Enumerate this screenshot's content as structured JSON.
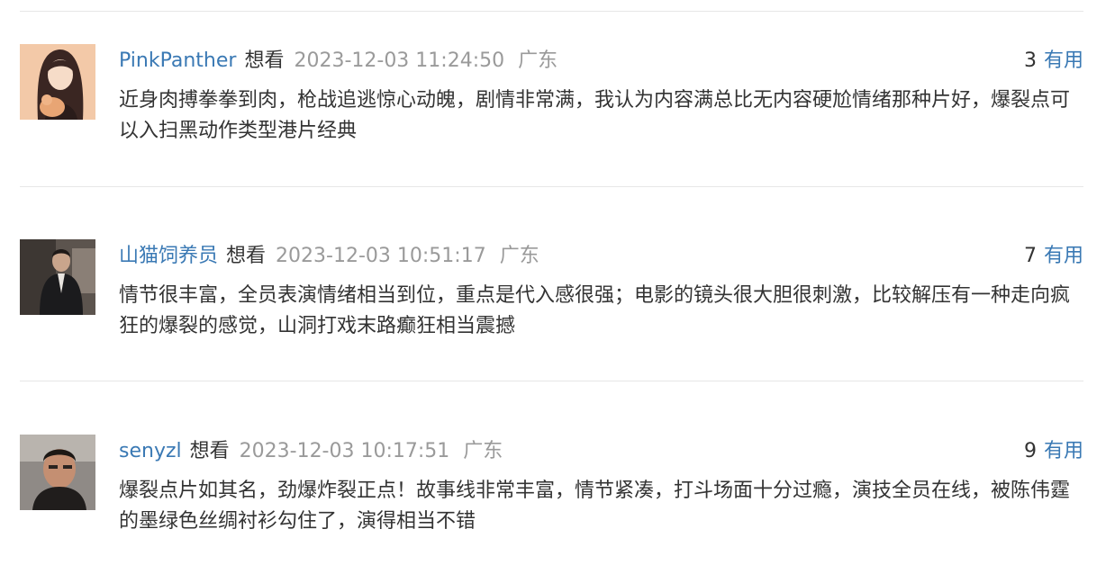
{
  "comments": [
    {
      "username": "PinkPanther",
      "status": "想看",
      "time": "2023-12-03 11:24:50",
      "location": "广东",
      "votes": "3",
      "vote_label": "有用",
      "content": "近身肉搏拳拳到肉，枪战追逃惊心动魄，剧情非常满，我认为内容满总比无内容硬尬情绪那种片好，爆裂点可以入扫黑动作类型港片经典"
    },
    {
      "username": "山猫饲养员",
      "status": "想看",
      "time": "2023-12-03 10:51:17",
      "location": "广东",
      "votes": "7",
      "vote_label": "有用",
      "content": "情节很丰富，全员表演情绪相当到位，重点是代入感很强；电影的镜头很大胆很刺激，比较解压有一种走向疯狂的爆裂的感觉，山洞打戏末路癫狂相当震撼"
    },
    {
      "username": "senyzl",
      "status": "想看",
      "time": "2023-12-03 10:17:51",
      "location": "广东",
      "votes": "9",
      "vote_label": "有用",
      "content": "爆裂点片如其名，劲爆炸裂正点！故事线非常丰富，情节紧凑，打斗场面十分过瘾，演技全员在线，被陈伟霆的墨绿色丝绸衬衫勾住了，演得相当不错"
    }
  ]
}
